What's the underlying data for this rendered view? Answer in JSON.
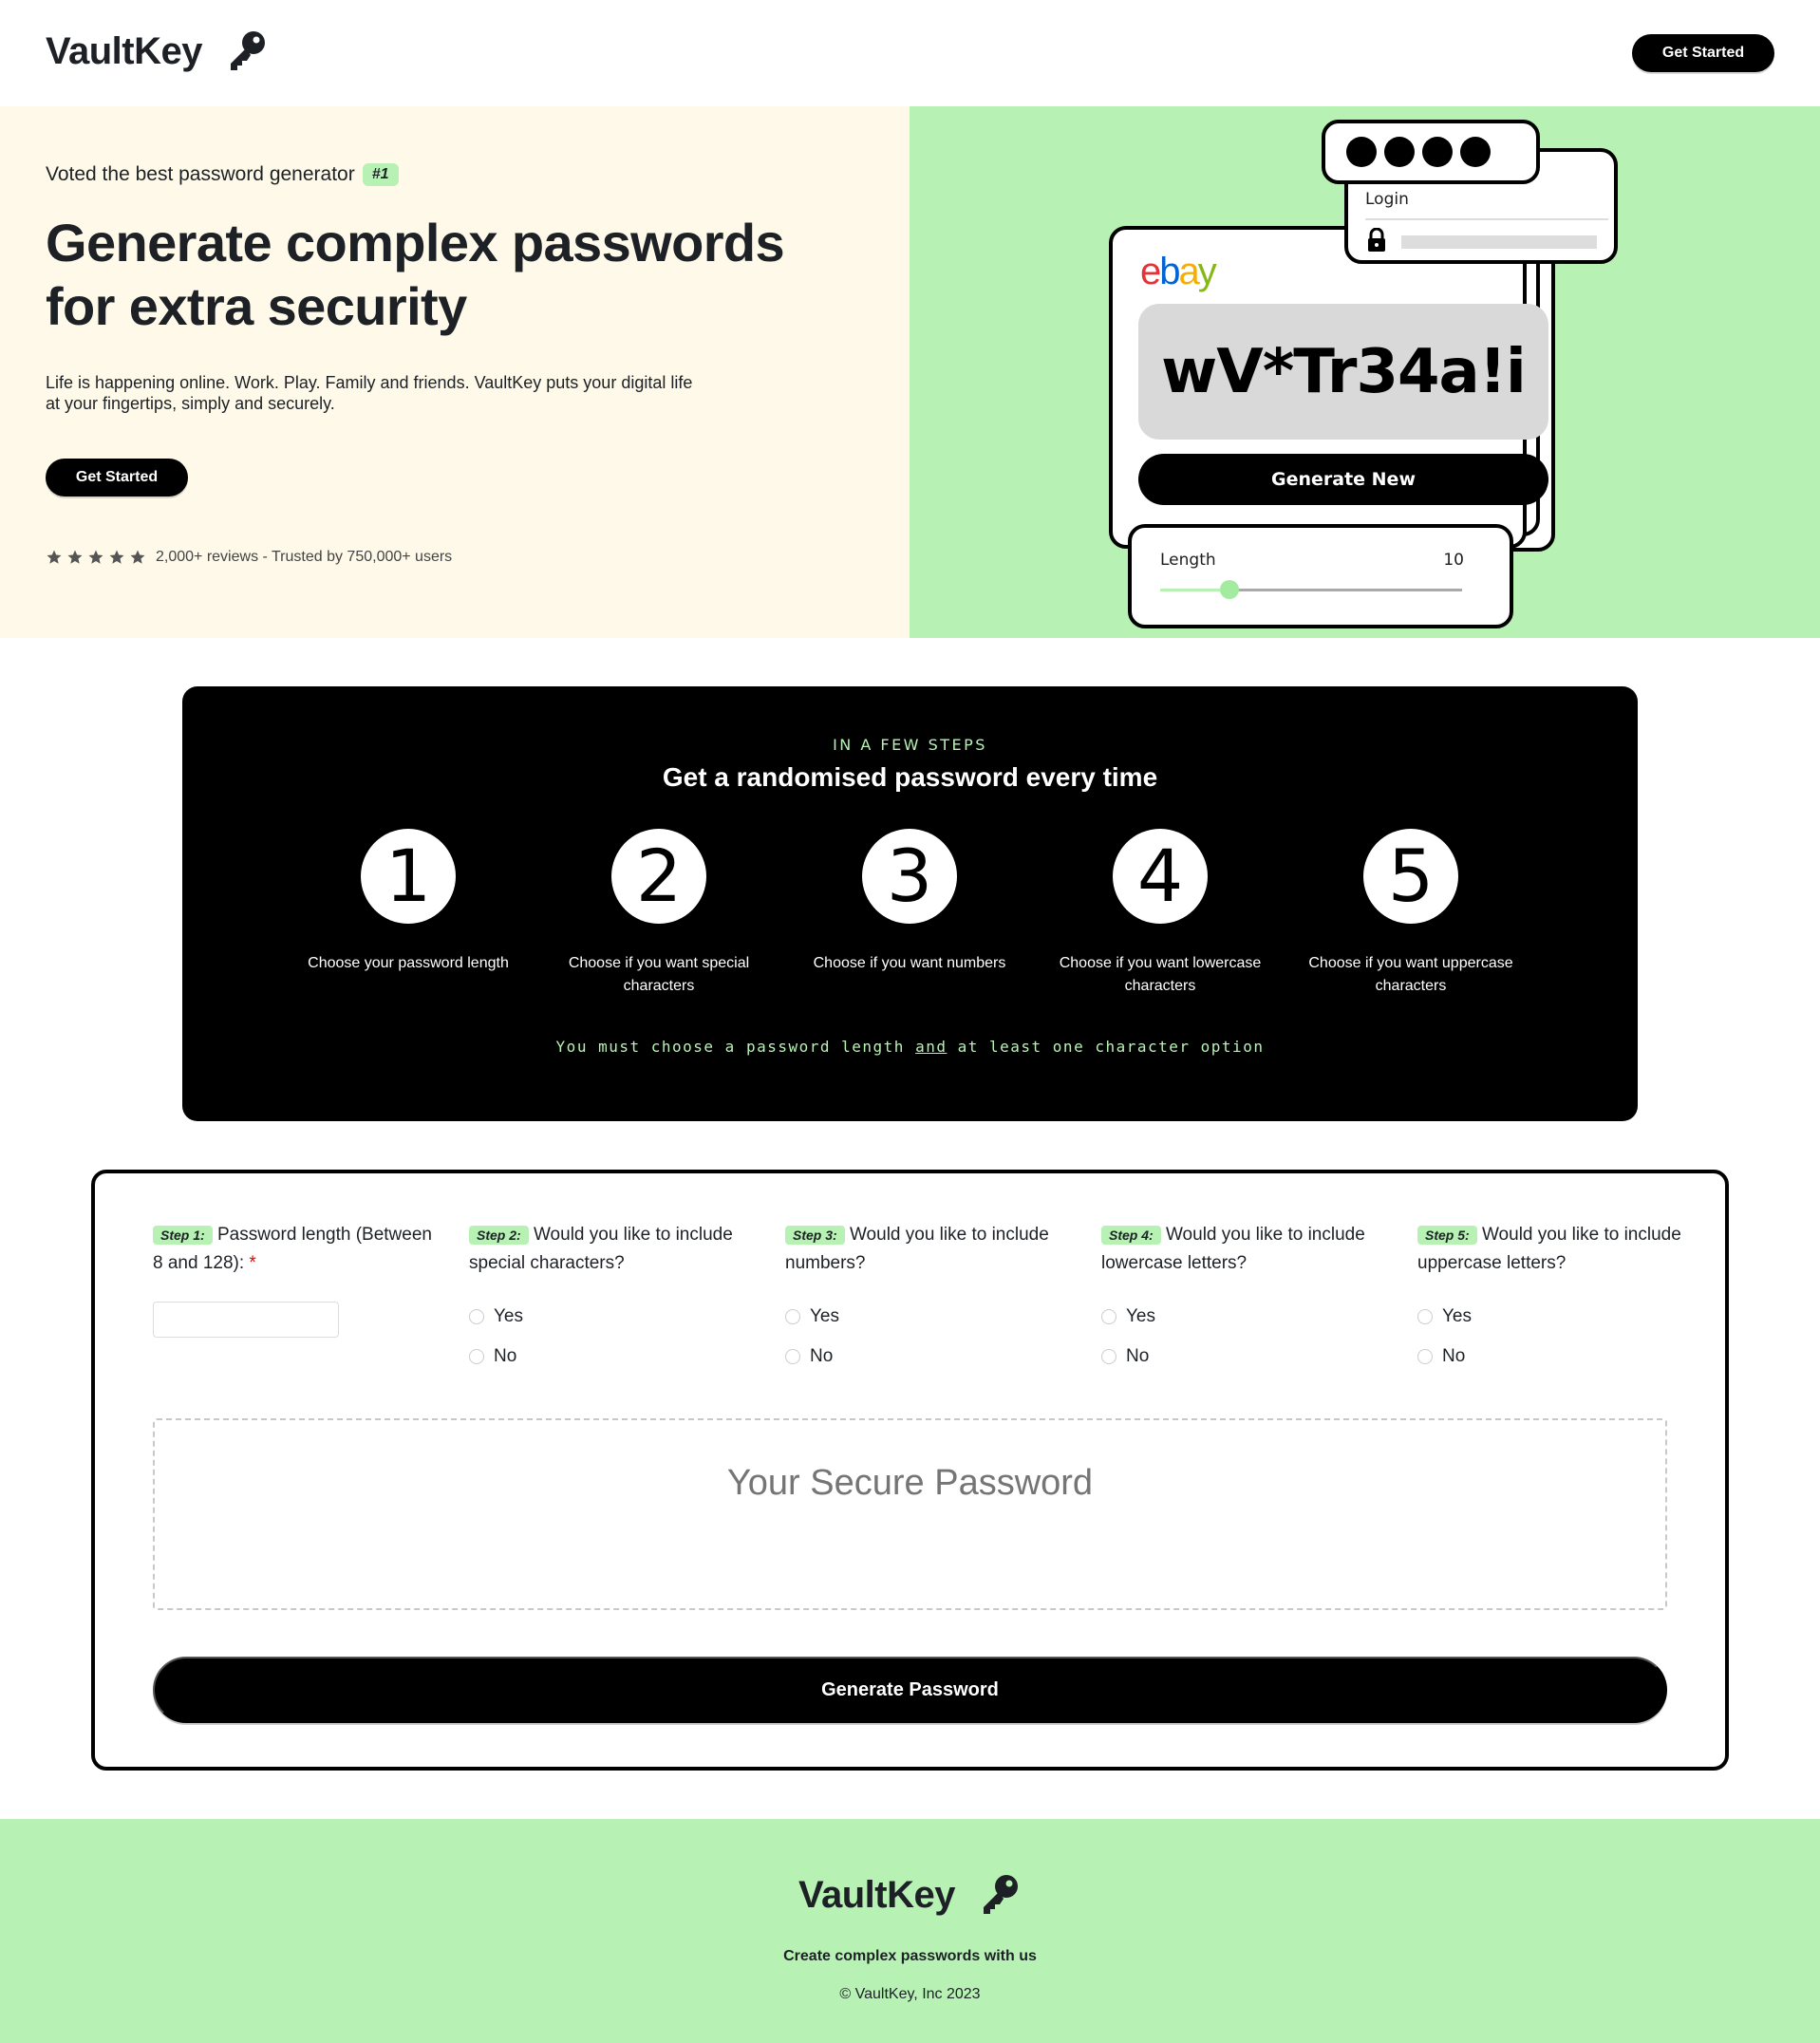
{
  "header": {
    "logo": "VaultKey",
    "cta": "Get Started"
  },
  "hero": {
    "voted": "Voted the best password generator",
    "badge": "#1",
    "title": "Generate complex passwords for extra security",
    "description": "Life is happening online. Work. Play. Family and friends. VaultKey puts your digital life at your fingertips, simply and securely.",
    "cta": "Get Started",
    "rating_text": "2,000+ reviews - Trusted by 750,000+ users",
    "stars": 5
  },
  "illustration": {
    "brand": "ebay",
    "password": "wV*Tr34a!i",
    "generate_new": "Generate New",
    "login_label": "Login",
    "length_label": "Length",
    "length_value": "10",
    "slider_fraction": 0.23
  },
  "steps": {
    "kicker": "IN A FEW STEPS",
    "title": "Get a randomised password every time",
    "items": [
      {
        "number": "1",
        "text": "Choose your password length"
      },
      {
        "number": "2",
        "text": "Choose if you want special characters"
      },
      {
        "number": "3",
        "text": "Choose if you want numbers"
      },
      {
        "number": "4",
        "text": "Choose if you want lowercase characters"
      },
      {
        "number": "5",
        "text": "Choose if you want uppercase characters"
      }
    ],
    "note_pre": "You must choose a password length ",
    "note_and": "and",
    "note_post": " at least one character option"
  },
  "form": {
    "questions": [
      {
        "tag": "Step 1:",
        "text": "Password length (Between 8 and 128):",
        "required": "*"
      },
      {
        "tag": "Step 2:",
        "text": "Would you like to include special characters?"
      },
      {
        "tag": "Step 3:",
        "text": "Would you like to include numbers?"
      },
      {
        "tag": "Step 4:",
        "text": "Would you like to include lowercase letters?"
      },
      {
        "tag": "Step 5:",
        "text": "Would you like to include uppercase letters?"
      }
    ],
    "yes": "Yes",
    "no": "No",
    "result_placeholder": "Your Secure Password",
    "generate_button": "Generate Password"
  },
  "footer": {
    "logo": "VaultKey",
    "tagline": "Create complex passwords with us",
    "copyright": "© VaultKey, Inc 2023"
  },
  "colors": {
    "accent_green": "#b7f2b4",
    "hero_cream": "#fef9e8",
    "black": "#000000"
  }
}
